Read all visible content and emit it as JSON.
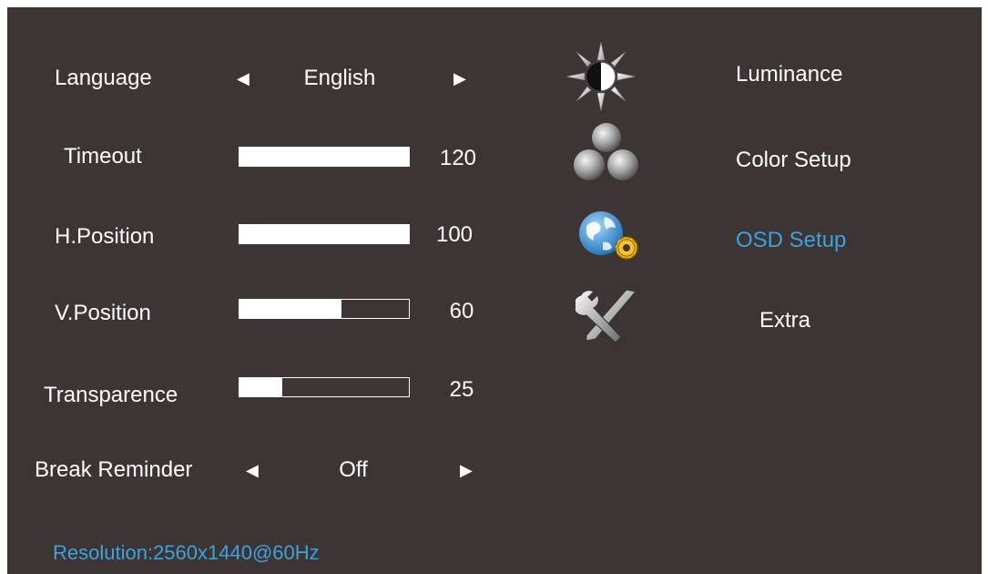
{
  "settings": [
    {
      "label": "Language",
      "type": "selector",
      "value": "English"
    },
    {
      "label": "Timeout",
      "type": "slider",
      "value": "120",
      "level": 1.0
    },
    {
      "label": "H.Position",
      "type": "slider",
      "value": "100",
      "level": 1.0
    },
    {
      "label": "V.Position",
      "type": "slider",
      "value": "60",
      "level": 0.6
    },
    {
      "label": "Transparence",
      "type": "slider",
      "value": "25",
      "level": 0.25
    },
    {
      "label": "Break Reminder",
      "type": "selector",
      "value": "Off"
    }
  ],
  "arrows": {
    "left": "◀",
    "right": "▶"
  },
  "menu": [
    {
      "label": "Luminance",
      "icon": "sun-icon",
      "active": false
    },
    {
      "label": "Color Setup",
      "icon": "color-spheres-icon",
      "active": false
    },
    {
      "label": "OSD Setup",
      "icon": "globe-gear-icon",
      "active": true
    },
    {
      "label": "Extra",
      "icon": "tools-icon",
      "active": false
    }
  ],
  "status": "Resolution:2560x1440@60Hz",
  "colors": {
    "background": "#3c3534",
    "accent": "#3aa3e0",
    "text": "#ffffff"
  }
}
